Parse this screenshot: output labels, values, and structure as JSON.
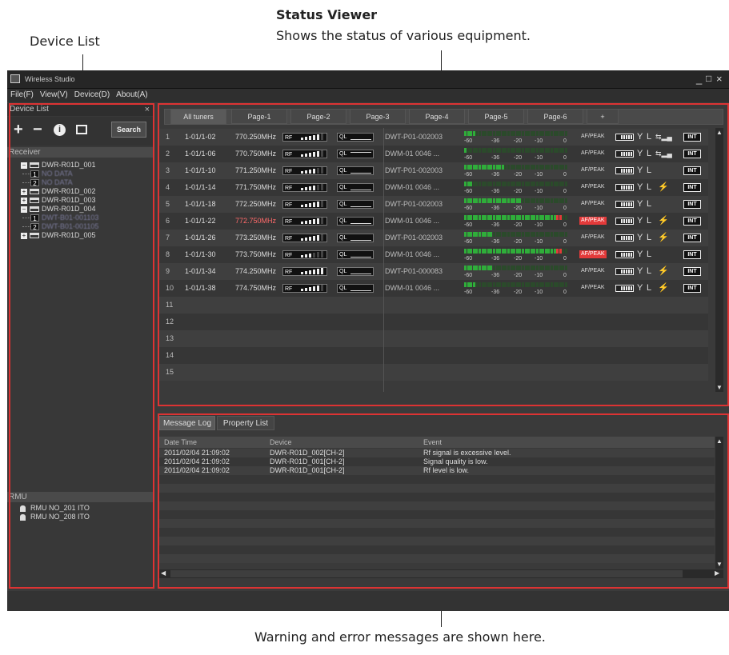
{
  "annotations": {
    "device_list": "Device List",
    "status_viewer_title": "Status Viewer",
    "status_viewer_desc": "Shows the status of various equipment.",
    "warning_desc": "Warning and error messages are shown here."
  },
  "window": {
    "title": "Wireless Studio",
    "controls": [
      "_",
      "□",
      "×"
    ]
  },
  "menu": [
    "File(F)",
    "View(V)",
    "Device(D)",
    "About(A)"
  ],
  "device_list": {
    "title": "Device List",
    "close": "×",
    "search_label": "Search",
    "receiver_header": "Receiver",
    "tree": [
      {
        "type": "receiver",
        "expander": "−",
        "label": "DWR-R01D_001"
      },
      {
        "type": "channel",
        "num": "1",
        "label": "NO DATA",
        "blurred": true
      },
      {
        "type": "channel",
        "num": "2",
        "label": "NO DATA",
        "blurred": true
      },
      {
        "type": "receiver",
        "expander": "+",
        "label": "DWR-R01D_002"
      },
      {
        "type": "receiver",
        "expander": "+",
        "label": "DWR-R01D_003"
      },
      {
        "type": "receiver",
        "expander": "−",
        "label": "DWR-R01D_004"
      },
      {
        "type": "channel",
        "num": "1",
        "label": "DWT-B01-001103",
        "blurred": true
      },
      {
        "type": "channel",
        "num": "2",
        "label": "DWT-B01-001105",
        "blurred": true
      },
      {
        "type": "receiver",
        "expander": "+",
        "label": "DWR-R01D_005"
      }
    ],
    "rmu_header": "RMU",
    "rmu": [
      "RMU NO_201 ITO",
      "RMU NO_208 ITO"
    ]
  },
  "status": {
    "tabs": [
      "All tuners",
      "Page-1",
      "Page-2",
      "Page-3",
      "Page-4",
      "Page-5",
      "Page-6",
      "+"
    ],
    "selected_tab": 0,
    "rf_label": "RF",
    "ql_label": "QL",
    "af_label": "AF/PEAK",
    "int_label": "INT",
    "af_scale": [
      "-60",
      "-36",
      "-20",
      "-10",
      "0"
    ],
    "rows": [
      {
        "n": "1",
        "ch": "1-01/1-02",
        "freq": "770.250MHz",
        "rf_level": 5,
        "ql_level": 0,
        "device": "DWT-P01-002003",
        "af_level": 4,
        "af_peak": false,
        "rf_warn": false,
        "signal": true,
        "freq_red": false
      },
      {
        "n": "2",
        "ch": "1-01/1-06",
        "freq": "770.750MHz",
        "rf_level": 5,
        "ql_level": 1,
        "device": "DWM-01 0046 ...",
        "af_level": 1,
        "af_peak": false,
        "rf_warn": false,
        "signal": true,
        "freq_red": false
      },
      {
        "n": "3",
        "ch": "1-01/1-10",
        "freq": "771.250MHz",
        "rf_level": 4,
        "ql_level": 0,
        "device": "DWT-P01-002003",
        "af_level": 14,
        "af_peak": false,
        "rf_warn": false,
        "signal": false,
        "freq_red": false
      },
      {
        "n": "4",
        "ch": "1-01/1-14",
        "freq": "771.750MHz",
        "rf_level": 4,
        "ql_level": 0,
        "device": "DWM-01 0046 ...",
        "af_level": 3,
        "af_peak": false,
        "rf_warn": true,
        "signal": false,
        "freq_red": false
      },
      {
        "n": "5",
        "ch": "1-01/1-18",
        "freq": "772.250MHz",
        "rf_level": 5,
        "ql_level": 0,
        "device": "DWT-P01-002003",
        "af_level": 20,
        "af_peak": false,
        "rf_warn": false,
        "signal": false,
        "freq_red": false
      },
      {
        "n": "6",
        "ch": "1-01/1-22",
        "freq": "772.750MHz",
        "rf_level": 5,
        "ql_level": 0,
        "device": "DWM-01 0046 ...",
        "af_level": 34,
        "af_peak": true,
        "rf_warn": true,
        "signal": false,
        "freq_red": true
      },
      {
        "n": "7",
        "ch": "1-01/1-26",
        "freq": "773.250MHz",
        "rf_level": 5,
        "ql_level": 0,
        "device": "DWT-P01-002003",
        "af_level": 10,
        "af_peak": false,
        "rf_warn": true,
        "signal": false,
        "freq_red": false
      },
      {
        "n": "8",
        "ch": "1-01/1-30",
        "freq": "773.750MHz",
        "rf_level": 3,
        "ql_level": 0,
        "device": "DWM-01 0046 ...",
        "af_level": 34,
        "af_peak": true,
        "rf_warn": false,
        "signal": false,
        "freq_red": false
      },
      {
        "n": "9",
        "ch": "1-01/1-34",
        "freq": "774.250MHz",
        "rf_level": 6,
        "ql_level": 0,
        "device": "DWT-P01-000083",
        "af_level": 10,
        "af_peak": false,
        "rf_warn": true,
        "signal": false,
        "freq_red": false
      },
      {
        "n": "10",
        "ch": "1-01/1-38",
        "freq": "774.750MHz",
        "rf_level": 5,
        "ql_level": 0,
        "device": "DWM-01 0046 ...",
        "af_level": 4,
        "af_peak": false,
        "rf_warn": true,
        "signal": false,
        "freq_red": false
      }
    ],
    "empty_rows": [
      "11",
      "12",
      "13",
      "14",
      "15"
    ]
  },
  "log": {
    "tabs": [
      "Message Log",
      "Property List"
    ],
    "columns": [
      "Date Time",
      "Device",
      "Event"
    ],
    "rows": [
      {
        "time": "2011/02/04  21:09:02",
        "device": "DWR-R01D_002[CH-2]",
        "event": "Rf signal is excessive level."
      },
      {
        "time": "2011/02/04  21:09:02",
        "device": "DWR-R01D_001[CH-2]",
        "event": "Signal quality is low."
      },
      {
        "time": "2011/02/04  21:09:02",
        "device": "DWR-R01D_001[CH-2]",
        "event": "Rf level is low."
      }
    ]
  },
  "colors": {
    "highlight_box": "#dd3333",
    "af_green": "#2fae3a",
    "af_red": "#e33a3a",
    "warn_red": "#e33a3a"
  }
}
